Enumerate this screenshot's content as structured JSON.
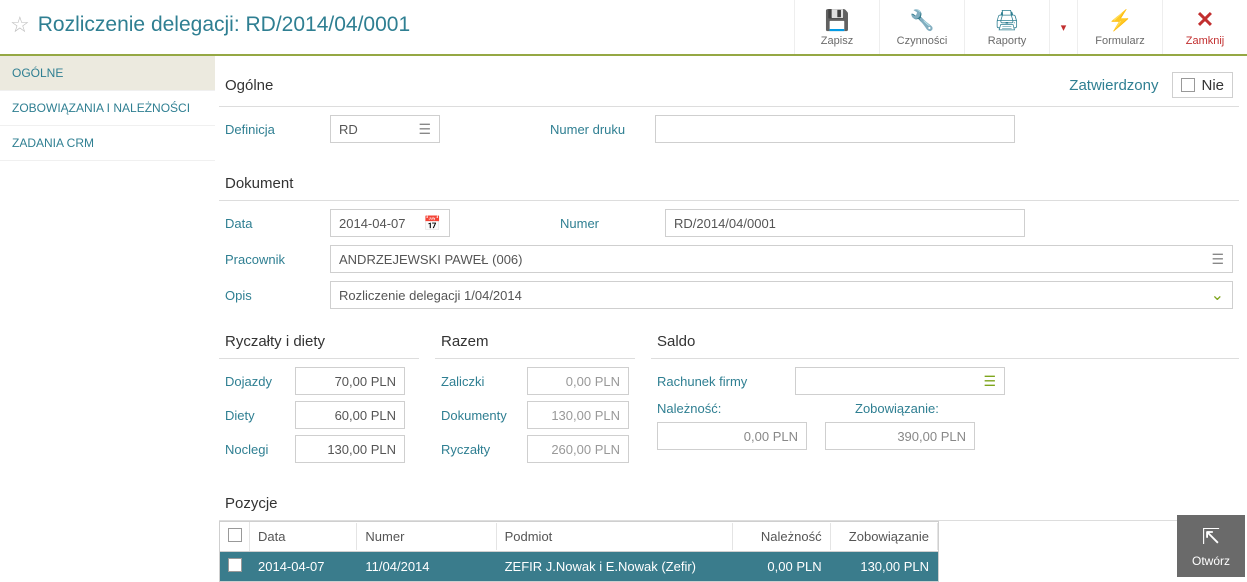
{
  "header": {
    "title": "Rozliczenie delegacji: RD/2014/04/0001",
    "toolbar": {
      "save": "Zapisz",
      "actions": "Czynności",
      "reports": "Raporty",
      "form": "Formularz",
      "close": "Zamknij"
    }
  },
  "sidebar": {
    "items": [
      {
        "label": "OGÓLNE",
        "active": true
      },
      {
        "label": "ZOBOWIĄZANIA I NALEŻNOŚCI",
        "active": false
      },
      {
        "label": "ZADANIA CRM",
        "active": false
      }
    ]
  },
  "general": {
    "section_title": "Ogólne",
    "status_label": "Zatwierdzony",
    "status_value": "Nie",
    "definicja_label": "Definicja",
    "definicja_value": "RD",
    "numer_druku_label": "Numer druku",
    "numer_druku_value": ""
  },
  "dokument": {
    "section_title": "Dokument",
    "data_label": "Data",
    "data_value": "2014-04-07",
    "numer_label": "Numer",
    "numer_value": "RD/2014/04/0001",
    "pracownik_label": "Pracownik",
    "pracownik_value": "ANDRZEJEWSKI PAWEŁ (006)",
    "opis_label": "Opis",
    "opis_value": "Rozliczenie delegacji 1/04/2014"
  },
  "ryczalty": {
    "section_title": "Ryczałty i diety",
    "dojazdy_label": "Dojazdy",
    "dojazdy_value": "70,00 PLN",
    "diety_label": "Diety",
    "diety_value": "60,00 PLN",
    "noclegi_label": "Noclegi",
    "noclegi_value": "130,00 PLN"
  },
  "razem": {
    "section_title": "Razem",
    "zaliczki_label": "Zaliczki",
    "zaliczki_value": "0,00 PLN",
    "dokumenty_label": "Dokumenty",
    "dokumenty_value": "130,00 PLN",
    "ryczalty_label": "Ryczałty",
    "ryczalty_value": "260,00 PLN"
  },
  "saldo": {
    "section_title": "Saldo",
    "rachunek_label": "Rachunek firmy",
    "rachunek_value": "",
    "naleznosc_label": "Należność:",
    "naleznosc_value": "0,00 PLN",
    "zobowiazanie_label": "Zobowiązanie:",
    "zobowiazanie_value": "390,00 PLN"
  },
  "pozycje": {
    "section_title": "Pozycje",
    "open_button": "Otwórz",
    "columns": {
      "data": "Data",
      "numer": "Numer",
      "podmiot": "Podmiot",
      "naleznosc": "Należność",
      "zobowiazanie": "Zobowiązanie"
    },
    "rows": [
      {
        "data": "2014-04-07",
        "numer": "11/04/2014",
        "podmiot": "ZEFIR J.Nowak i E.Nowak (Zefir)",
        "naleznosc": "0,00 PLN",
        "zobowiazanie": "130,00 PLN"
      }
    ]
  }
}
